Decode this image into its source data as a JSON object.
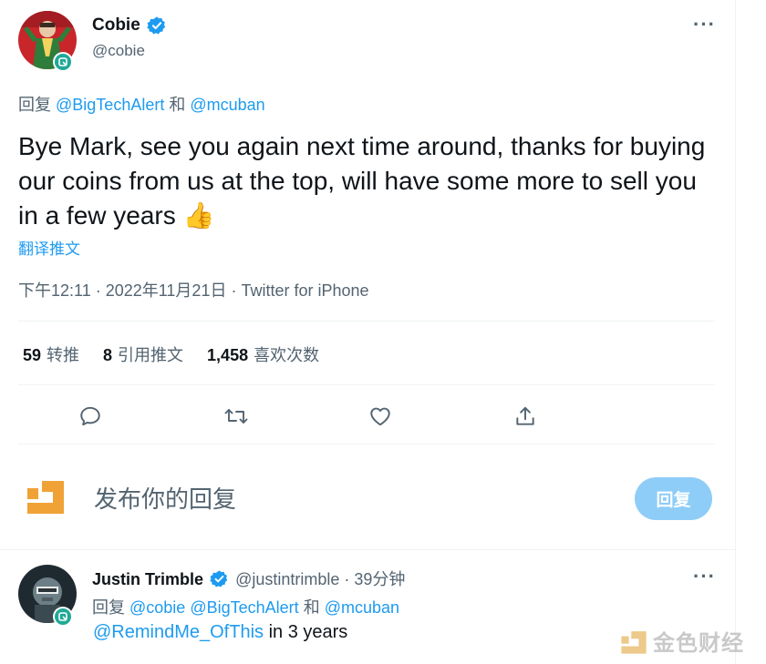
{
  "tweet": {
    "author_name": "Cobie",
    "author_handle": "@cobie",
    "replying_prefix": "回复",
    "replying_to_1": "@BigTechAlert",
    "replying_and": "和",
    "replying_to_2": "@mcuban",
    "text": "Bye Mark, see you again next time around, thanks for buying our coins from us at the top, will have some more to sell you in a few years 👍",
    "translate_label": "翻译推文",
    "timestamp": "下午12:11 · 2022年11月21日 · Twitter for iPhone",
    "stats": {
      "retweets_count": "59",
      "retweets_label": "转推",
      "quotes_count": "8",
      "quotes_label": "引用推文",
      "likes_count": "1,458",
      "likes_label": "喜欢次数"
    }
  },
  "compose": {
    "placeholder": "发布你的回复",
    "reply_button": "回复"
  },
  "reply": {
    "author_name": "Justin Trimble",
    "author_handle": "@justintrimble",
    "time": "· 39分钟",
    "replying_prefix": "回复",
    "replying_to_1": "@cobie",
    "replying_to_2": "@BigTechAlert",
    "replying_and": "和",
    "replying_to_3": "@mcuban",
    "mention": "@RemindMe_OfThis",
    "text_rest": " in 3 years"
  },
  "watermark": {
    "text": "金色财经"
  },
  "colors": {
    "accent": "#1d9bf0",
    "verified": "#1d9bf0",
    "muted": "#536471",
    "badge": "#21a897",
    "brand_orange": "#f0a236"
  },
  "icons": [
    "verified-icon",
    "more-icon",
    "reply-icon",
    "retweet-icon",
    "like-icon",
    "share-icon"
  ]
}
